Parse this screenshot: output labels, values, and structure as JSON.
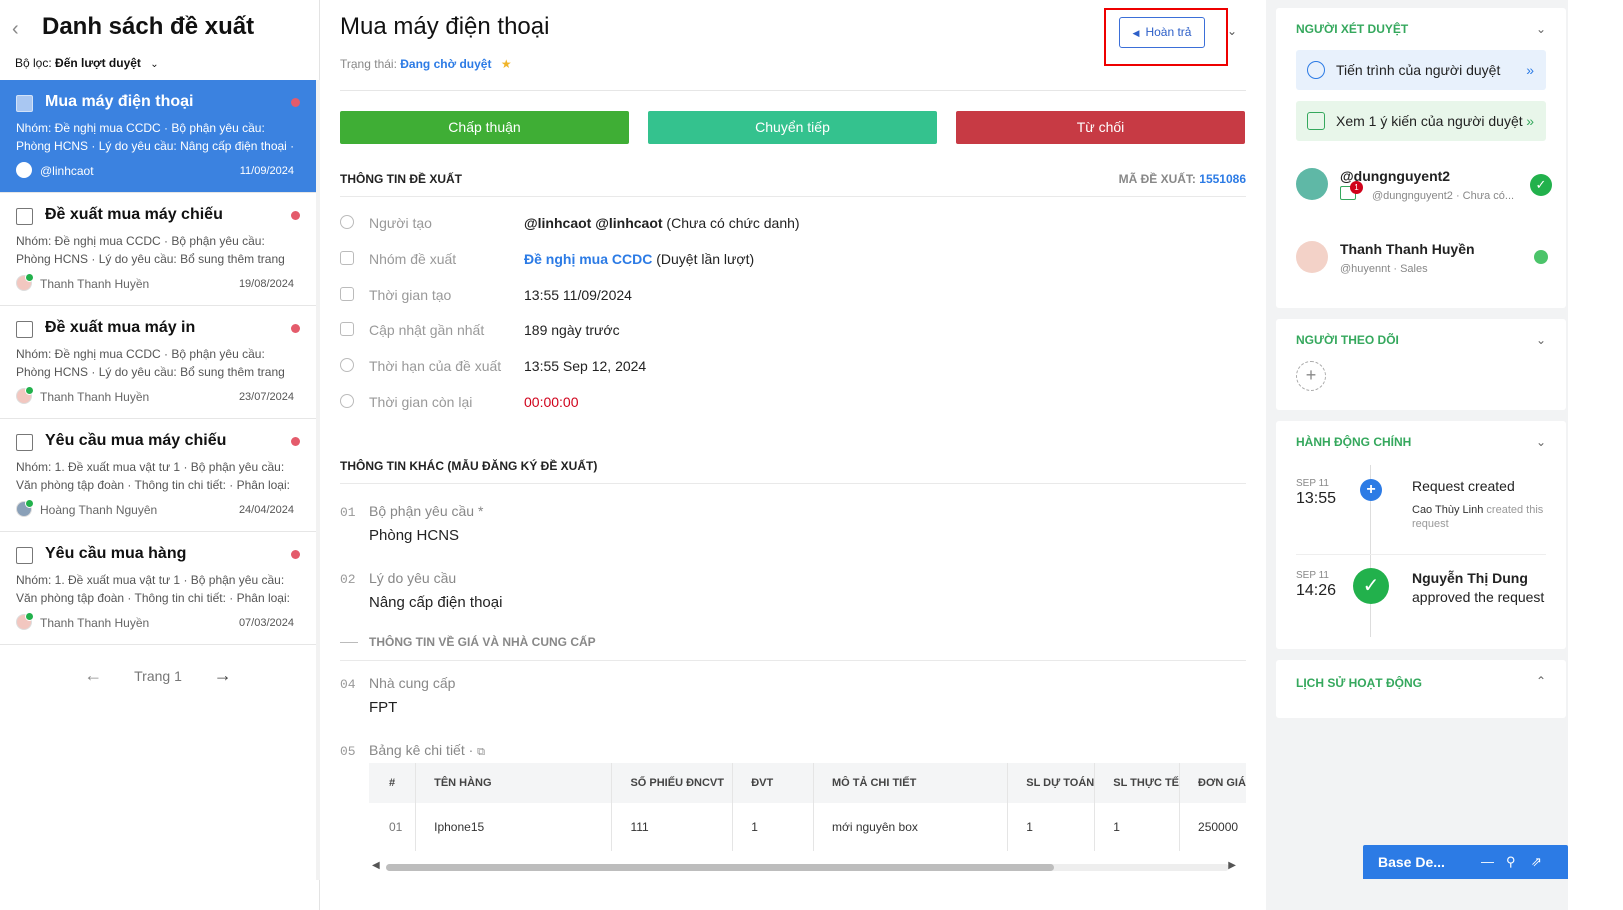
{
  "left": {
    "title": "Danh sách đề xuất",
    "filter_label": "Bộ lọc:",
    "filter_value": "Đến lượt duyệt",
    "cards": [
      {
        "title": "Mua máy điện thoại",
        "desc": "Nhóm: Đề nghị mua CCDC · Bộ phận yêu cầu: Phòng HCNS · Lý do yêu cầu: Nâng cấp điện thoại · Thông ti...",
        "author": "@linhcaot",
        "date": "11/09/2024"
      },
      {
        "title": "Đề xuất mua máy chiếu",
        "desc": "Nhóm: Đề nghị mua CCDC · Bộ phận yêu cầu: Phòng HCNS · Lý do yêu cầu: Bổ sung thêm trang thiết bị · ...",
        "author": "Thanh Thanh Huyền",
        "date": "19/08/2024"
      },
      {
        "title": "Đề xuất mua máy in",
        "desc": "Nhóm: Đề nghị mua CCDC · Bộ phận yêu cầu: Phòng HCNS · Lý do yêu cầu: Bổ sung thêm trang thiết bị · ...",
        "author": "Thanh Thanh Huyền",
        "date": "23/07/2024"
      },
      {
        "title": "Yêu cầu mua máy chiếu",
        "desc": "Nhóm: 1. Đề xuất mua vật tư 1 · Bộ phận yêu cầu: Văn phòng tập đoàn · Thông tin chi tiết: · Phân loại: Trong...",
        "author": "Hoàng Thanh Nguyên",
        "date": "24/04/2024"
      },
      {
        "title": "Yêu cầu mua hàng",
        "desc": "Nhóm: 1. Đề xuất mua vật tư 1 · Bộ phận yêu cầu: Văn phòng tập đoàn · Thông tin chi tiết: · Phân loại: Trong...",
        "author": "Thanh Thanh Huyền",
        "date": "07/03/2024"
      }
    ],
    "page_label": "Trang 1"
  },
  "main": {
    "title": "Mua máy điện thoại",
    "status_label": "Trạng thái:",
    "status_value": "Đang chờ duyệt",
    "return_label": "Hoàn trả",
    "actions": {
      "approve": "Chấp thuận",
      "forward": "Chuyển tiếp",
      "reject": "Từ chối"
    },
    "section_info": "THÔNG TIN ĐỀ XUẤT",
    "code_label": "MÃ ĐỀ XUẤT:",
    "code_value": "1551086",
    "info": {
      "creator_label": "Người tạo",
      "creator_value": "@linhcaot @linhcaot",
      "creator_suffix": "(Chưa có chức danh)",
      "group_label": "Nhóm đề xuất",
      "group_value": "Đề nghị mua CCDC",
      "group_suffix": "(Duyệt lần lượt)",
      "created_label": "Thời gian tạo",
      "created_value": "13:55 11/09/2024",
      "updated_label": "Cập nhật gần nhất",
      "updated_value": "189 ngày trước",
      "deadline_label": "Thời hạn của đề xuất",
      "deadline_value": "13:55 Sep 12, 2024",
      "remaining_label": "Thời gian còn lại",
      "remaining_value": "00:00:00"
    },
    "section_other": "THÔNG TIN KHÁC (MẪU ĐĂNG KÝ ĐỀ XUẤT)",
    "fields": [
      {
        "num": "01",
        "label": "Bộ phận yêu cầu *",
        "value": "Phòng HCNS"
      },
      {
        "num": "02",
        "label": "Lý do yêu cầu",
        "value": "Nâng cấp điện thoại"
      },
      {
        "num": "04",
        "label": "Nhà cung cấp",
        "value": "FPT"
      },
      {
        "num": "05",
        "label": "Bảng kê chi tiết ·",
        "value": ""
      }
    ],
    "subsection": "THÔNG TIN VỀ GIÁ VÀ NHÀ CUNG CẤP",
    "table": {
      "headers": [
        "#",
        "TÊN HÀNG",
        "SỐ PHIẾU ĐNCVT",
        "ĐVT",
        "MÔ TẢ CHI TIẾT",
        "SL DỰ TOÁN",
        "SL THỰC TẾ",
        "ĐƠN GIÁ ("
      ],
      "rows": [
        [
          "01",
          "Iphone15",
          "111",
          "1",
          "mới nguyên box",
          "1",
          "1",
          "250000"
        ]
      ]
    }
  },
  "right": {
    "approvers_title": "NGƯỜI XÉT DUYỆT",
    "progress_btn": "Tiến trình của người duyệt",
    "opinion_btn": "Xem 1 ý kiến của người duyệt",
    "approvers": [
      {
        "name": "@dungnguyent2",
        "sub": "@dungnguyent2 · Chưa có...",
        "badge": "1"
      },
      {
        "name": "Thanh Thanh Huyền",
        "sub": "@huyennt · Sales"
      }
    ],
    "followers_title": "NGƯỜI THEO DÕI",
    "actions_title": "HÀNH ĐỘNG CHÍNH",
    "timeline": [
      {
        "mon": "SEP 11",
        "time": "13:55",
        "title": "Request created",
        "actor": "Cao Thùy Linh",
        "rest": "created this request"
      },
      {
        "mon": "SEP 11",
        "time": "14:26",
        "title": "Nguyễn Thị Dung",
        "rest": "approved the request"
      }
    ],
    "history_title": "LỊCH SỬ HOẠT ĐỘNG"
  },
  "chat": {
    "label": "Base De..."
  }
}
